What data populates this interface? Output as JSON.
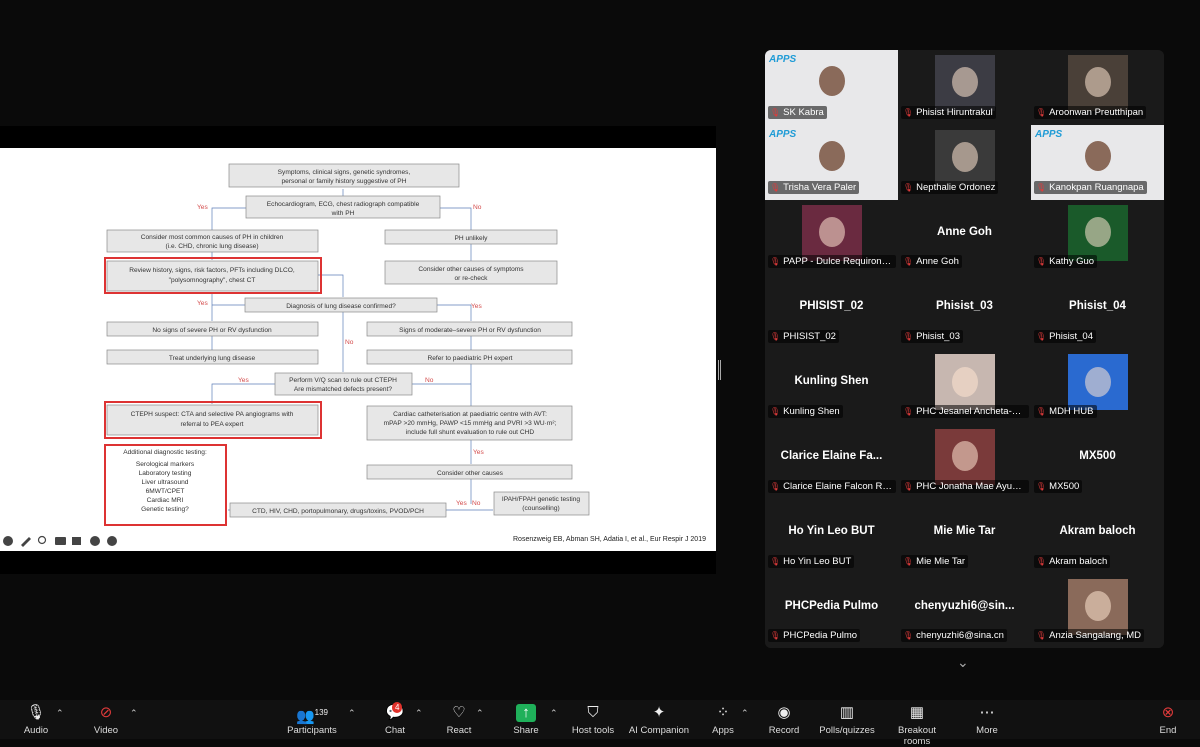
{
  "slide": {
    "flowchart": {
      "top": [
        "Symptoms, clinical signs, genetic syndromes,",
        "personal or family history suggestive of PH"
      ],
      "echo": [
        "Echocardiogram, ECG, chest radiograph compatible",
        "with PH"
      ],
      "yes": "Yes",
      "no": "No",
      "consider_common": [
        "Consider most common causes of PH in children",
        "(i.e. CHD, chronic lung disease)"
      ],
      "ph_unlikely": "PH unlikely",
      "review": [
        "Review history, signs, risk factors, PFTs including DLCO,",
        "\"polysomnography\", chest CT"
      ],
      "consider_other": [
        "Consider other causes of symptoms",
        "or re-check"
      ],
      "diagnosis_confirmed": "Diagnosis of lung disease confirmed?",
      "no_signs": "No signs of severe PH or RV dysfunction",
      "signs_moderate": "Signs of moderate–severe PH or RV dysfunction",
      "treat": "Treat underlying lung disease",
      "refer": "Refer to paediatric PH expert",
      "vq": [
        "Perform V/Q scan to rule out CTEPH",
        "Are mismatched defects present?"
      ],
      "cteph": [
        "CTEPH suspect: CTA and selective PA angiograms with",
        "referral to PEA expert"
      ],
      "cath": [
        "Cardiac catheterisation at paediatric centre with AVT:",
        "mPAP >20 mmHg, PAWP <15 mmHg and PVRI >3 WU·m²;",
        "include full shunt evaluation to rule out CHD"
      ],
      "additional_title": "Additional diagnostic testing:",
      "additional_items": [
        "Serological markers",
        "Laboratory testing",
        "Liver ultrasound",
        "6MWT/CPET",
        "Cardiac MRI",
        "Genetic testing?"
      ],
      "consider_causes": "Consider other causes",
      "ctd": "CTD, HIV, CHD, portopulmonary, drugs/toxins, PVOD/PCH",
      "ipah": [
        "IPAH/FPAH genetic testing",
        "(counselling)"
      ],
      "citation": "Rosenzweig EB, Abman SH, Adatia I, et al., Eur Respir J 2019"
    }
  },
  "gallery": {
    "participants": [
      {
        "label": "SK Kabra",
        "big": "",
        "video": true,
        "logo": "APPS"
      },
      {
        "label": "Phisist Hiruntrakul",
        "big": "",
        "video": false,
        "avatar": true
      },
      {
        "label": "Aroonwan Preutthipan",
        "big": "",
        "video": false,
        "avatar": true
      },
      {
        "label": "Trisha Vera Paler",
        "big": "",
        "video": true,
        "logo": "APPS"
      },
      {
        "label": "Nepthalie Ordonez",
        "big": "",
        "video": false,
        "avatar": true
      },
      {
        "label": "Kanokpan Ruangnapa",
        "big": "",
        "video": true,
        "logo": "APPS",
        "active": true
      },
      {
        "label": "PAPP - Dulce Requiron-Syjuco",
        "big": "",
        "video": false,
        "avatar": true
      },
      {
        "label": "Anne Goh",
        "big": "Anne Goh",
        "video": false
      },
      {
        "label": "Kathy Guo",
        "big": "",
        "video": false,
        "avatar": true
      },
      {
        "label": "PHISIST_02",
        "big": "PHISIST_02",
        "video": false
      },
      {
        "label": "Phisist_03",
        "big": "Phisist_03",
        "video": false
      },
      {
        "label": "Phisist_04",
        "big": "Phisist_04",
        "video": false
      },
      {
        "label": "Kunling Shen",
        "big": "Kunling Shen",
        "video": false
      },
      {
        "label": "PHC Jesanel Ancheta-Marcelino",
        "big": "",
        "video": false,
        "avatar": true
      },
      {
        "label": "MDH HUB",
        "big": "",
        "video": false,
        "avatar": true
      },
      {
        "label": "Clarice Elaine Falcon Ramos",
        "big": "Clarice  Elaine  Fa...",
        "video": false
      },
      {
        "label": "PHC Jonatha Mae Ayuntiong",
        "big": "",
        "video": false,
        "avatar": true
      },
      {
        "label": "MX500",
        "big": "MX500",
        "video": false
      },
      {
        "label": "Ho Yin Leo BUT",
        "big": "Ho Yin Leo BUT",
        "video": false
      },
      {
        "label": "Mie Mie Tar",
        "big": "Mie Mie Tar",
        "video": false
      },
      {
        "label": "Akram baloch",
        "big": "Akram baloch",
        "video": false
      },
      {
        "label": "PHCPedia Pulmo",
        "big": "PHCPedia Pulmo",
        "video": false
      },
      {
        "label": "chenyuzhi6@sina.cn",
        "big": "chenyuzhi6@sin...",
        "video": false
      },
      {
        "label": "Anzia Sangalang, MD",
        "big": "",
        "video": false,
        "avatar": true
      }
    ]
  },
  "toolbar": {
    "audio": "Audio",
    "video": "Video",
    "participants": "Participants",
    "participants_count": "139",
    "chat": "Chat",
    "chat_badge": "4",
    "react": "React",
    "share": "Share",
    "host_tools": "Host tools",
    "ai": "AI Companion",
    "apps": "Apps",
    "record": "Record",
    "polls": "Polls/quizzes",
    "breakout": "Breakout rooms",
    "more": "More",
    "end": "End"
  }
}
